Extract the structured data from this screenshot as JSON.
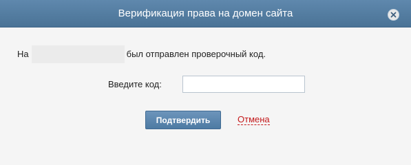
{
  "dialog": {
    "title": "Верификация права на домен сайта",
    "close_icon": "close-icon"
  },
  "message": {
    "prefix": "На",
    "suffix": "был отправлен проверочный код."
  },
  "code_field": {
    "label": "Введите код:",
    "value": ""
  },
  "actions": {
    "confirm_label": "Подтвердить",
    "cancel_label": "Отмена"
  },
  "colors": {
    "titlebar": "#4f7aa0",
    "primary_button": "#5a86ae",
    "cancel_link": "#c4191b"
  }
}
